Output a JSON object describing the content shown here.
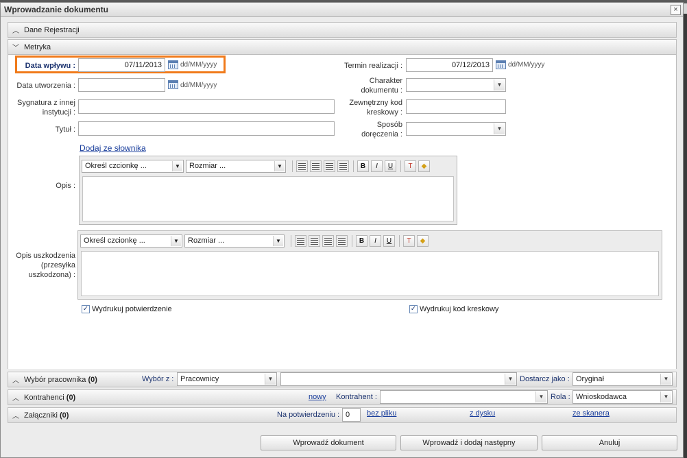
{
  "dialog": {
    "title": "Wprowadzanie dokumentu",
    "close_glyph": "×"
  },
  "panels": {
    "dane": "Dane Rejestracji",
    "metryka": "Metryka",
    "wybor": {
      "label": "Wybór pracownika",
      "count": "(0)"
    },
    "kontrahenci": {
      "label": "Kontrahenci",
      "count": "(0)"
    },
    "zalaczniki": {
      "label": "Załączniki",
      "count": "(0)"
    }
  },
  "form": {
    "data_wplywu": {
      "label": "Data wpływu :",
      "value": "07/11/2013",
      "format": "dd/MM/yyyy"
    },
    "data_utworzenia": {
      "label": "Data utworzenia :",
      "value": "",
      "format": "dd/MM/yyyy"
    },
    "sygnatura": {
      "label_1": "Sygnatura z innej",
      "label_2": "instytucji :",
      "value": ""
    },
    "tytul": {
      "label": "Tytuł :",
      "value": ""
    },
    "termin": {
      "label": "Termin realizacji :",
      "value": "07/12/2013",
      "format": "dd/MM/yyyy"
    },
    "charakter": {
      "label_1": "Charakter",
      "label_2": "dokumentu :",
      "value": ""
    },
    "kod": {
      "label_1": "Zewnętrzny kod",
      "label_2": "kreskowy :",
      "value": ""
    },
    "sposob": {
      "label_1": "Sposób",
      "label_2": "doręczenia :",
      "value": ""
    },
    "dodaj_link": "Dodaj ze słownika",
    "opis": {
      "label": "Opis :"
    },
    "opis_uszk": {
      "label_1": "Opis uszkodzenia",
      "label_2": "(przesyłka",
      "label_3": "uszkodzona) :"
    },
    "font_placeholder": "Określ czcionkę ...",
    "size_placeholder": "Rozmiar ...",
    "bold": "B",
    "italic": "I",
    "underline": "U",
    "chk_potw": {
      "label": "Wydrukuj potwierdzenie",
      "checked": true
    },
    "chk_kod": {
      "label": "Wydrukuj kod kreskowy",
      "checked": true
    }
  },
  "wybor": {
    "label": "Wybór z :",
    "value": "Pracownicy",
    "second": "",
    "dostarcz_label": "Dostarcz jako :",
    "dostarcz_value": "Oryginał"
  },
  "kontr": {
    "nowy": "nowy",
    "label": "Kontrahent :",
    "value": "",
    "rola_label": "Rola :",
    "rola_value": "Wnioskodawca"
  },
  "zal": {
    "label": "Na potwierdzeniu :",
    "value": "0",
    "bez_pliku": "bez pliku",
    "z_dysku": "z dysku",
    "ze_skanera": "ze skanera"
  },
  "buttons": {
    "wprowadz": "Wprowadź dokument",
    "wprowadz_nast": "Wprowadź i dodaj następny",
    "anuluj": "Anuluj"
  }
}
